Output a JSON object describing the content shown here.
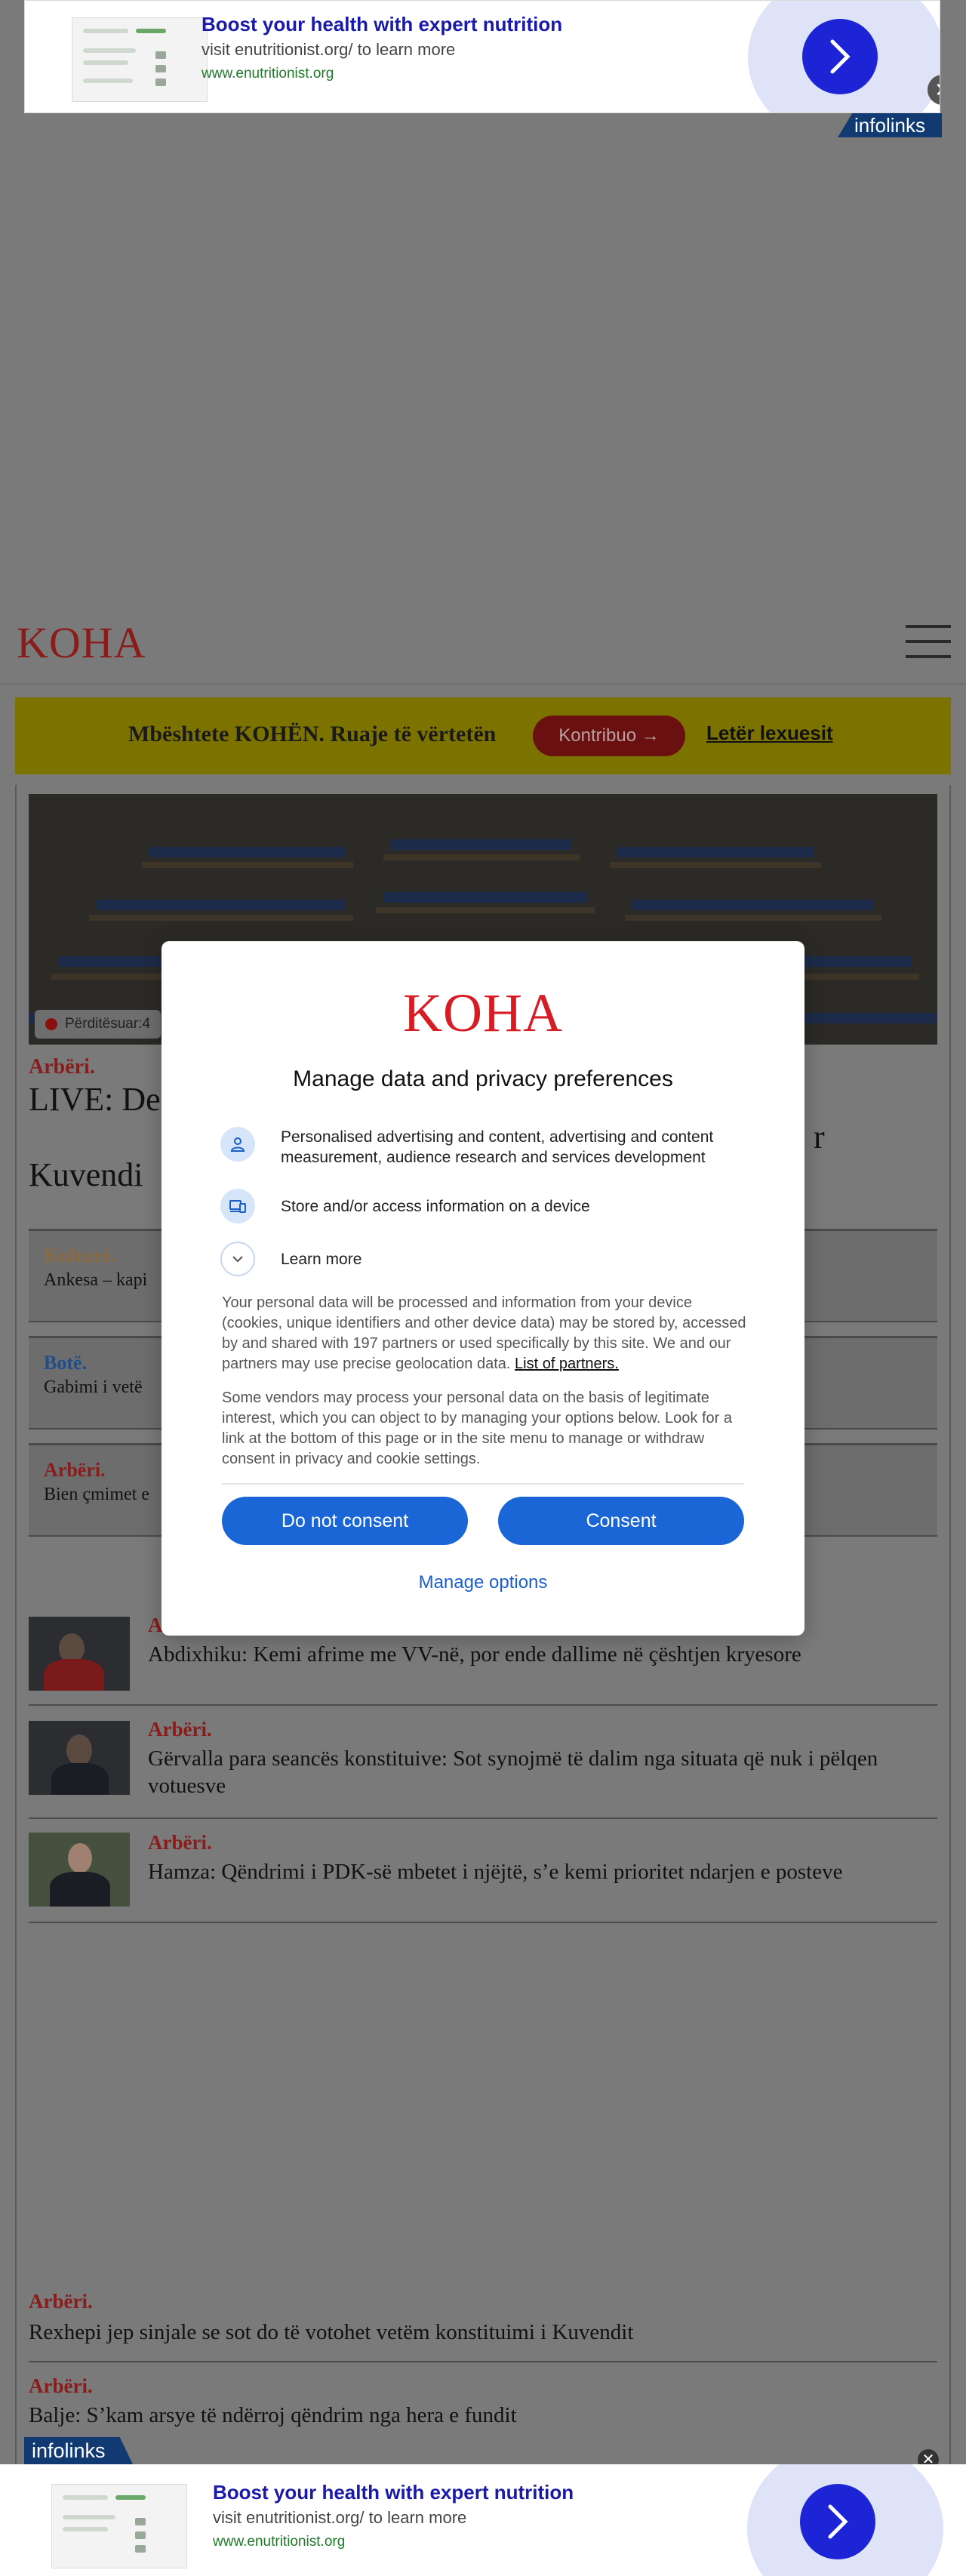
{
  "top_ad": {
    "title": "Boost your health with expert nutrition",
    "subtitle": "visit enutritionist.org/ to learn more",
    "url": "www.enutritionist.org",
    "close_glyph": "✕",
    "infolinks_label": "infolinks"
  },
  "header": {
    "logo": "KOHA",
    "menu_icon": "hamburger-icon"
  },
  "support_banner": {
    "text": "Mbështete KOHËN. Ruaje të vërtetën",
    "button_label": "Kontribuo →",
    "link_label": "Letër lexuesit"
  },
  "hero": {
    "updated_label": "Përditësuar:4",
    "category": "Arbëri.",
    "title_start": "LIVE: De",
    "title_end": "r",
    "title_line2": "Kuvendi"
  },
  "boxes": [
    {
      "category": "Kulturë.",
      "category_color": "#8a6a40",
      "title": "Ankesa – kapi"
    },
    {
      "category": "Botë.",
      "category_color": "#1e4e8c",
      "title": "Gabimi i vetë"
    },
    {
      "category": "Arbëri.",
      "category_color": "#8a1c1c",
      "title": "Bien çmimet e"
    }
  ],
  "list": [
    {
      "category": "A",
      "title": "Abdixhiku: Kemi afrime me VV-në, por ende dallime në çështjen kryesore"
    },
    {
      "category": "Arbëri.",
      "title": "Gërvalla para seancës konstituive: Sot synojmë të dalim nga situata që nuk i pëlqen votuesve"
    },
    {
      "category": "Arbëri.",
      "title": "Hamza: Qëndrimi i PDK-së mbetet i njëjtë, s’e kemi prioritet ndarjen e posteve"
    }
  ],
  "plain_list": [
    {
      "category": "Arbëri.",
      "title": "Rexhepi jep sinjale se sot do të votohet vetëm konstituimi i Kuvendit"
    },
    {
      "category": "Arbëri.",
      "title": "Balje: S’kam arsye të ndërroj qëndrim nga hera e fundit"
    }
  ],
  "bottom_ad": {
    "infolinks_label": "infolinks",
    "title": "Boost your health with expert nutrition",
    "subtitle": "visit enutritionist.org/ to learn more",
    "url": "www.enutritionist.org",
    "close_glyph": "✕"
  },
  "consent": {
    "logo": "KOHA",
    "heading": "Manage data and privacy preferences",
    "purposes": [
      {
        "icon": "person-icon",
        "text": "Personalised advertising and content, advertising and content measurement, audience research and services development"
      },
      {
        "icon": "device-icon",
        "text": "Store and/or access information on a device"
      }
    ],
    "learn_more": "Learn more",
    "description_1": "Your personal data will be processed and information from your device (cookies, unique identifiers and other device data) may be stored by, accessed by and shared with 197 partners or used specifically by this site. We and our partners may use precise geolocation data.",
    "partners_link": "List of partners.",
    "description_2": "Some vendors may process your personal data on the basis of legitimate interest, which you can object to by managing your options below. Look for a link at the bottom of this page or in the site menu to manage or withdraw consent in privacy and cookie settings.",
    "do_not_consent": "Do not consent",
    "consent": "Consent",
    "manage_options": "Manage options"
  },
  "colors": {
    "brand_red": "#d81c24",
    "button_blue": "#1a66d6",
    "ad_title_blue": "#1a1aa8",
    "overlay": "#7a7a7a"
  }
}
